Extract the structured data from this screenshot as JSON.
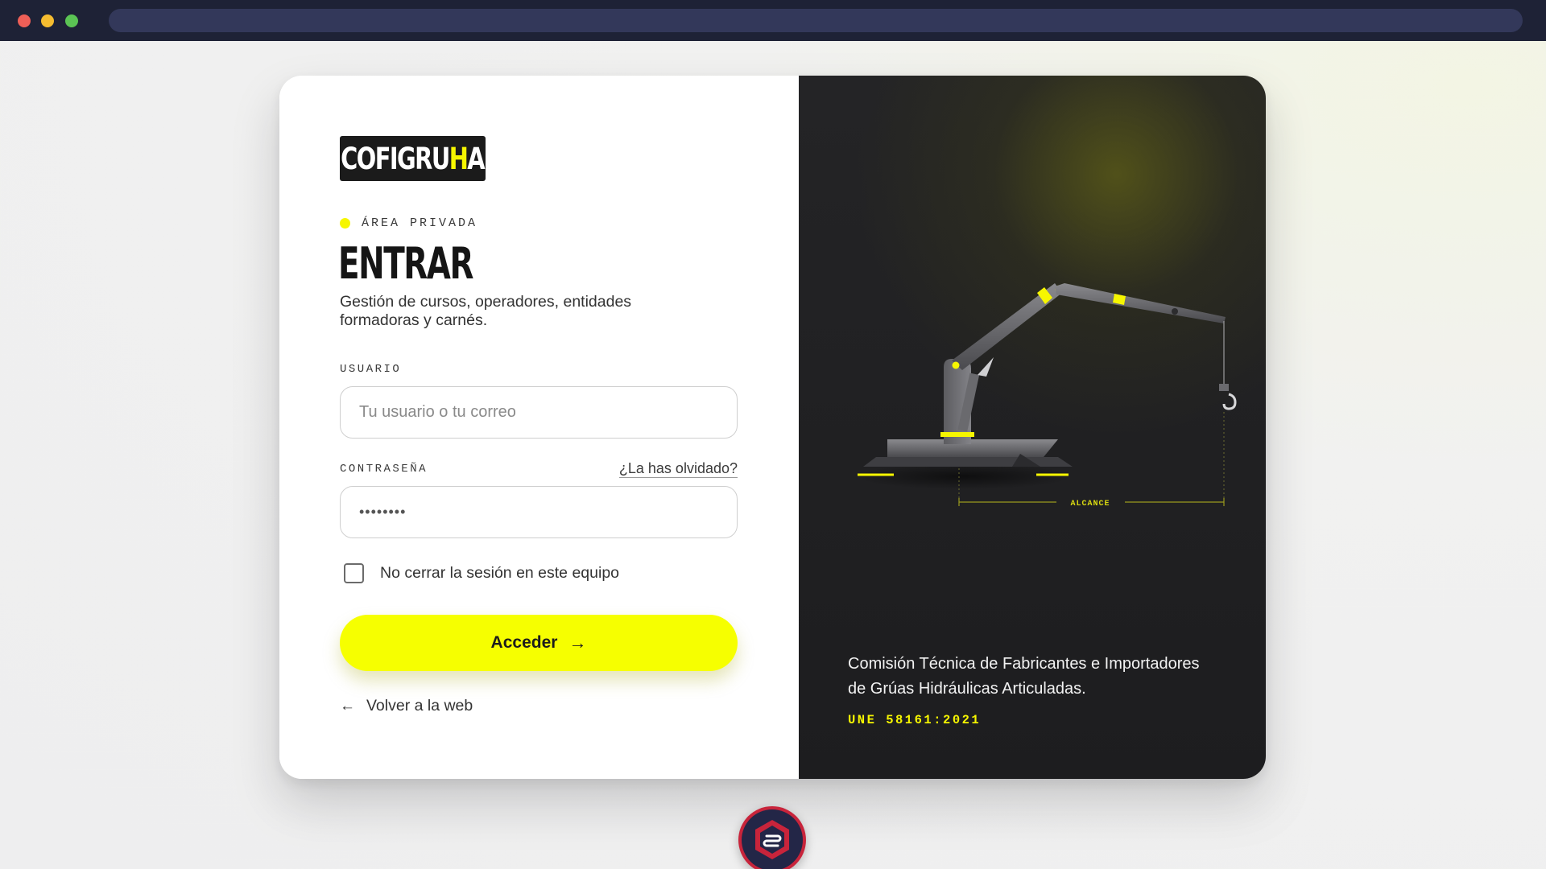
{
  "browser": {
    "title": ""
  },
  "login": {
    "logo": {
      "main": "COFIGRU",
      "accent": "H",
      "tail": "A"
    },
    "eyebrow": "ÁREA PRIVADA",
    "heading": "ENTRAR",
    "subtitle": "Gestión de cursos, operadores, entidades formadoras y carnés.",
    "username": {
      "label": "USUARIO",
      "placeholder": "Tu usuario o tu correo"
    },
    "password": {
      "label": "CONTRASEÑA",
      "value": "••••••••",
      "forgot": "¿La has olvidado?"
    },
    "remember": {
      "label": "No cerrar la sesión en este equipo",
      "checked": false
    },
    "submit": {
      "label": "Acceder",
      "icon": "arrow-right-icon"
    },
    "back": {
      "label": "Volver a la web",
      "icon": "arrow-left-icon"
    }
  },
  "aside": {
    "dimension_label": "ALCANCE",
    "organization": "Comisión Técnica de Fabricantes e Importadores de Grúas Hidráulicas Articuladas.",
    "standard": "UNE 58161:2021"
  },
  "colors": {
    "accent": "#f6ff00",
    "dark_panel": "#1f1f21",
    "chrome": "#1e2236",
    "badge_red": "#c8243b"
  }
}
